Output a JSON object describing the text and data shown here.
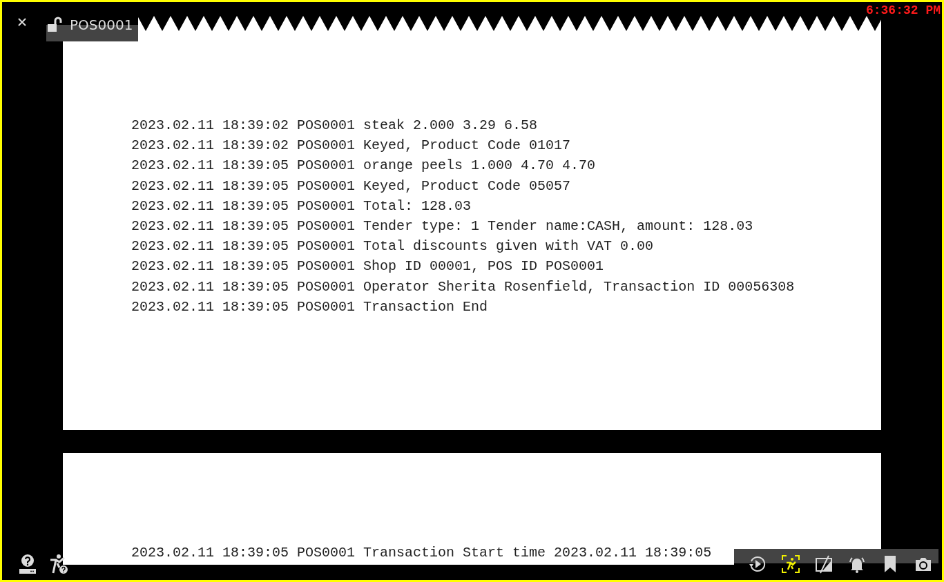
{
  "header": {
    "title": "POS0001",
    "locked": false,
    "clock": "6:36:32 PM"
  },
  "receipt_lines": [
    "2023.02.11 18:39:02 POS0001 steak 2.000 3.29 6.58",
    "2023.02.11 18:39:02 POS0001 Keyed, Product Code 01017",
    "2023.02.11 18:39:05 POS0001 orange peels 1.000 4.70 4.70",
    "2023.02.11 18:39:05 POS0001 Keyed, Product Code 05057",
    "2023.02.11 18:39:05 POS0001 Total: 128.03",
    "2023.02.11 18:39:05 POS0001 Tender type: 1 Tender name:CASH, amount: 128.03",
    "2023.02.11 18:39:05 POS0001 Total discounts given with VAT 0.00",
    "2023.02.11 18:39:05 POS0001 Shop ID 00001, POS ID POS0001",
    "2023.02.11 18:39:05 POS0001 Operator Sherita Rosenfield, Transaction ID 00056308",
    "2023.02.11 18:39:05 POS0001 Transaction End"
  ],
  "next_receipt_lines": [
    "2023.02.11 18:39:05 POS0001 Transaction Start time 2023.02.11 18:39:05"
  ],
  "left_tools": [
    {
      "kind": "device-help"
    },
    {
      "kind": "motion-help"
    }
  ],
  "right_tools": [
    {
      "kind": "replay",
      "on": false
    },
    {
      "kind": "motion",
      "on": true
    },
    {
      "kind": "mask",
      "on": false
    },
    {
      "kind": "alarm",
      "on": false
    },
    {
      "kind": "bookmark",
      "on": false
    },
    {
      "kind": "snapshot",
      "on": false
    }
  ]
}
